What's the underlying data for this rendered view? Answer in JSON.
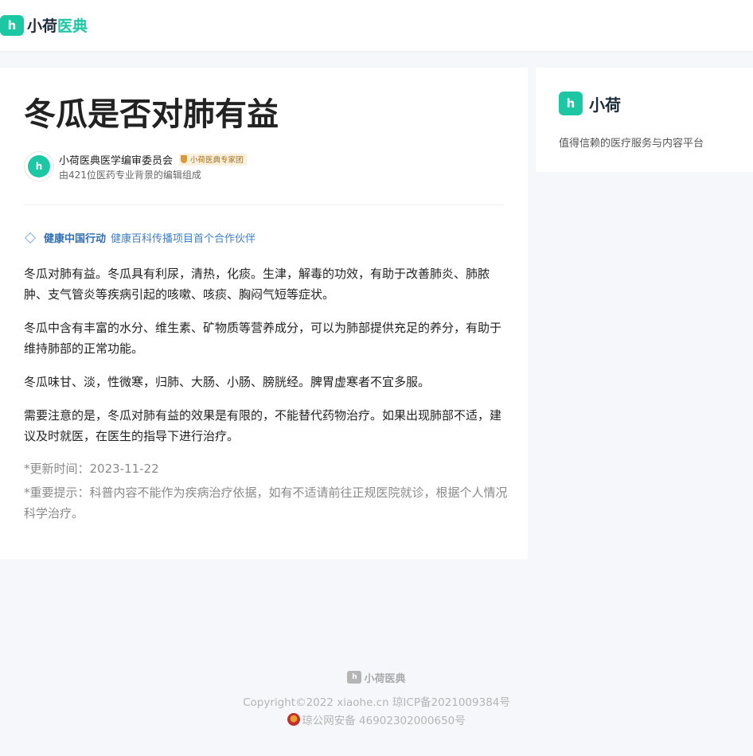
{
  "header": {
    "logo_mark": "h",
    "logo_text_a": "小荷",
    "logo_text_b": "医典"
  },
  "article": {
    "title": "冬瓜是否对肺有益",
    "author": {
      "avatar_mark": "h",
      "name": "小荷医典医学编审委员会",
      "badge": "小荷医典专家团",
      "description": "由421位医药专业背景的编辑组成"
    },
    "partner": {
      "strong": "健康中国行动",
      "light": "健康百科传播项目首个合作伙伴"
    },
    "paragraphs": [
      "冬瓜对肺有益。冬瓜具有利尿，清热，化痰。生津，解毒的功效，有助于改善肺炎、肺脓肿、支气管炎等疾病引起的咳嗽、咳痰、胸闷气短等症状。",
      "冬瓜中含有丰富的水分、维生素、矿物质等营养成分，可以为肺部提供充足的养分，有助于维持肺部的正常功能。",
      "冬瓜味甘、淡，性微寒，归肺、大肠、小肠、膀胱经。脾胃虚寒者不宜多服。",
      "需要注意的是，冬瓜对肺有益的效果是有限的，不能替代药物治疗。如果出现肺部不适，建议及时就医，在医生的指导下进行治疗。"
    ],
    "update_time": "*更新时间：2023-11-22",
    "notice": "*重要提示：科普内容不能作为疾病治疗依据，如有不适请前往正规医院就诊，根据个人情况科学治疗。"
  },
  "sidebar": {
    "logo_mark": "h",
    "name": "小荷",
    "slogan": "值得信赖的医疗服务与内容平台"
  },
  "footer": {
    "logo_mark": "h",
    "logo_text": "小荷医典",
    "copyright": "Copyright©2022 xiaohe.cn 琼ICP备2021009384号",
    "police": "琼公网安备 46902302000650号"
  },
  "colors": {
    "brand": "#1cc7a3",
    "link": "#2f6fb5",
    "background": "#f6f7fb"
  },
  "icons": [
    "logo-icon",
    "diamond-icon",
    "shield-icon",
    "police-emblem-icon"
  ]
}
